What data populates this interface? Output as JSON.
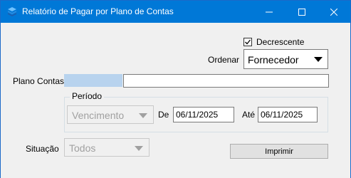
{
  "window": {
    "title": "Relatório de Pagar por Plano de Contas",
    "icon": "stack-icon",
    "controls": {
      "minimize": "minimize-icon",
      "maximize": "maximize-icon",
      "close": "close-icon"
    }
  },
  "form": {
    "decrescente": {
      "label": "Decrescente",
      "checked": true
    },
    "ordenar": {
      "label": "Ordenar",
      "selected": "Fornecedor"
    },
    "plano_contas": {
      "label": "Plano Contas",
      "code": "",
      "description": ""
    },
    "periodo": {
      "legend": "Período",
      "tipo": "Vencimento",
      "de_label": "De",
      "de_value": "06/11/2025",
      "ate_label": "Até",
      "ate_value": "06/11/2025"
    },
    "situacao": {
      "label": "Situação",
      "selected": "Todos"
    },
    "imprimir_label": "Imprimir"
  },
  "colors": {
    "titlebar": "#0078d7",
    "selection": "#b8d3ee"
  }
}
